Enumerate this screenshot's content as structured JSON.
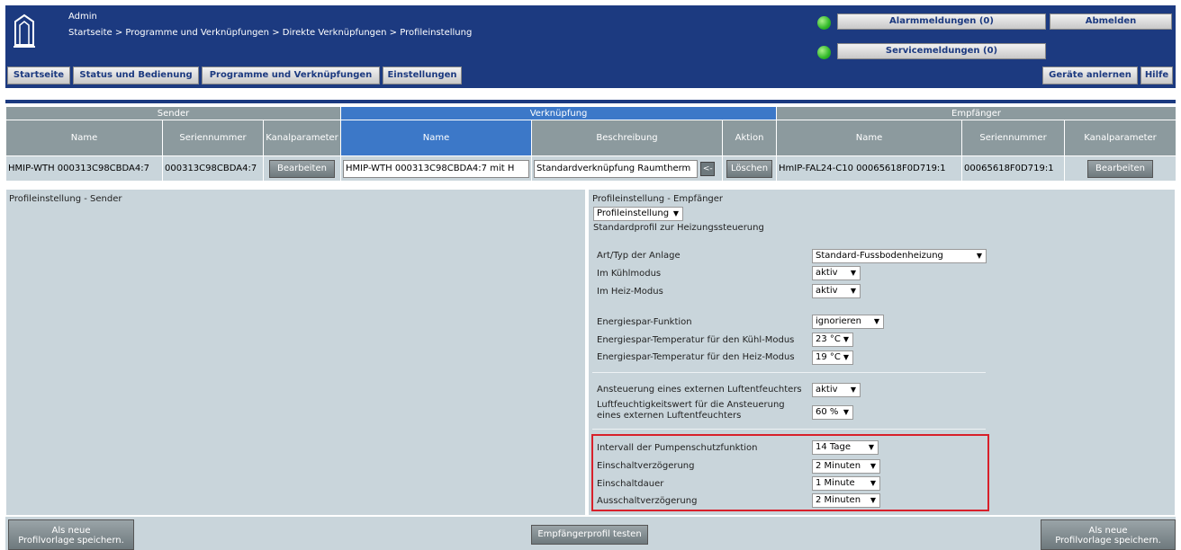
{
  "header": {
    "user": "Admin",
    "breadcrumb": "Startseite > Programme und Verknüpfungen > Direkte Verknüpfungen > Profileinstellung",
    "alarm_label": "Alarmmeldungen (0)",
    "service_label": "Servicemeldungen (0)",
    "logout_label": "Abmelden",
    "teach_label": "Geräte anlernen",
    "help_label": "Hilfe"
  },
  "menu": {
    "home": "Startseite",
    "status": "Status und Bedienung",
    "programs": "Programme und Verknüpfungen",
    "settings": "Einstellungen"
  },
  "table": {
    "groups": {
      "sender": "Sender",
      "link": "Verknüpfung",
      "receiver": "Empfänger"
    },
    "columns": {
      "s_name": "Name",
      "s_serial": "Seriennummer",
      "s_param": "Kanalparameter",
      "l_name": "Name",
      "l_desc": "Beschreibung",
      "l_action": "Aktion",
      "r_name": "Name",
      "r_serial": "Seriennummer",
      "r_param": "Kanalparameter"
    },
    "row": {
      "s_name": "HMIP-WTH 000313C98CBDA4:7",
      "s_serial": "000313C98CBDA4:7",
      "s_edit": "Bearbeiten",
      "l_name": "HMIP-WTH 000313C98CBDA4:7 mit H",
      "l_desc": "Standardverknüpfung Raumtherm",
      "l_desc_btn": "<-",
      "l_delete": "Löschen",
      "r_name": "HmIP-FAL24-C10 00065618F0D719:1",
      "r_serial": "00065618F0D719:1",
      "r_edit": "Bearbeiten"
    }
  },
  "sender_panel": {
    "title": "Profileinstellung - Sender"
  },
  "receiver_panel": {
    "title": "Profileinstellung - Empfänger",
    "profile_select": "Profileinstellung",
    "profile_desc": "Standardprofil zur Heizungssteuerung",
    "settings": [
      {
        "label": "Art/Typ der Anlage",
        "value": "Standard-Fussbodenheizung"
      },
      {
        "label": "Im Kühlmodus",
        "value": "aktiv"
      },
      {
        "label": "Im Heiz-Modus",
        "value": "aktiv"
      },
      {
        "label": "Energiespar-Funktion",
        "value": "ignorieren"
      },
      {
        "label": "Energiespar-Temperatur für den Kühl-Modus",
        "value": "23 °C"
      },
      {
        "label": "Energiespar-Temperatur für den Heiz-Modus",
        "value": "19 °C"
      },
      {
        "label": "Ansteuerung eines externen Luftentfeuchters",
        "value": "aktiv"
      },
      {
        "label": "Luftfeuchtigkeitswert für die Ansteuerung",
        "label2": "eines externen Luftentfeuchters",
        "value": "60 %"
      },
      {
        "label": "Intervall der Pumpenschutzfunktion",
        "value": "14 Tage"
      },
      {
        "label": "Einschaltverzögerung",
        "value": "2 Minuten"
      },
      {
        "label": "Einschaltdauer",
        "value": "1 Minute"
      },
      {
        "label": "Ausschaltverzögerung",
        "value": "2 Minuten"
      }
    ]
  },
  "bottom": {
    "save_left_1": "Als neue",
    "save_left_2": "Profilvorlage speichern.",
    "test": "Empfängerprofil testen",
    "save_right_1": "Als neue",
    "save_right_2": "Profilvorlage speichern."
  },
  "colors": {
    "header": "#1c3a80",
    "accent": "#3c78c8",
    "panel": "#c9d5db",
    "highlight": "#d8202a"
  }
}
